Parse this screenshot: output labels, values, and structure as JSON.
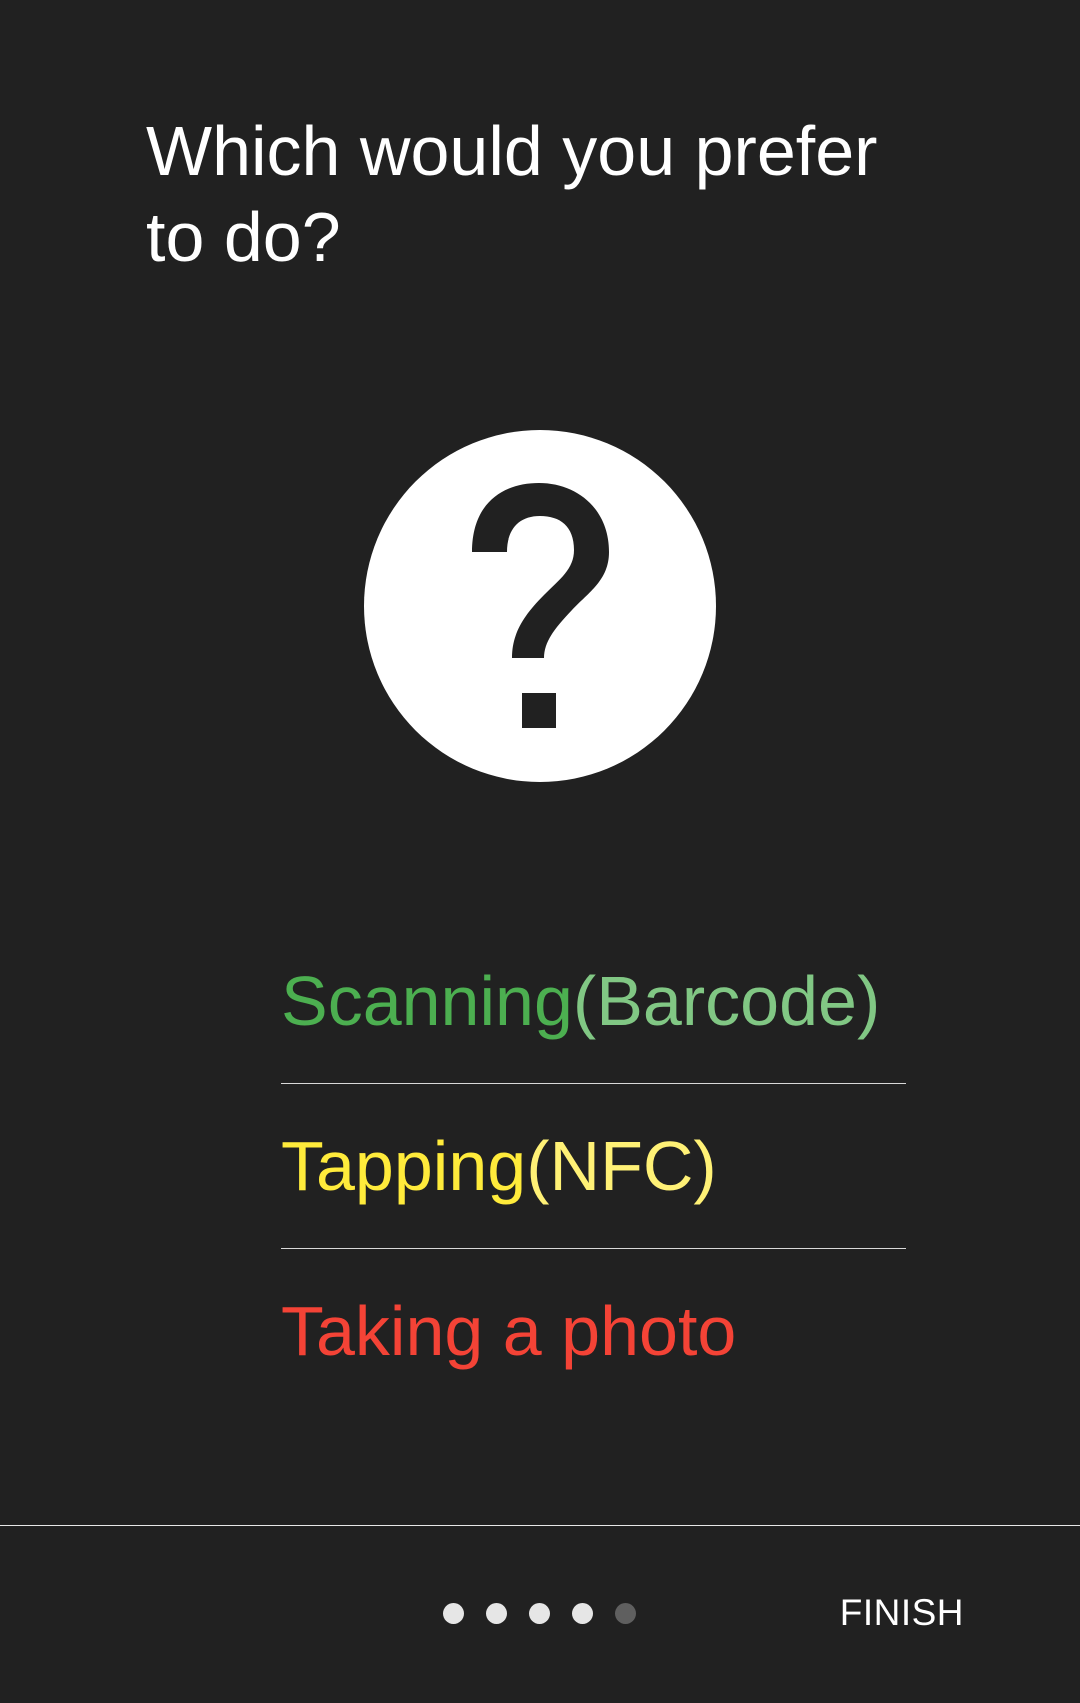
{
  "header": {
    "title": "Which would you prefer to do?"
  },
  "hero": {
    "icon": "help-circle-icon"
  },
  "options": [
    {
      "main": "Scanning ",
      "paren": "(Barcode)",
      "main_color": "#4caf50",
      "paren_color": "#81c784"
    },
    {
      "main": "Tapping ",
      "paren": "(NFC)",
      "main_color": "#ffeb3b",
      "paren_color": "#fff176"
    },
    {
      "main": "Taking a photo",
      "paren": "",
      "main_color": "#f44336",
      "paren_color": "#f44336"
    }
  ],
  "footer": {
    "finish_label": "FINISH",
    "page_indicator": {
      "total": 5,
      "current": 4
    }
  }
}
